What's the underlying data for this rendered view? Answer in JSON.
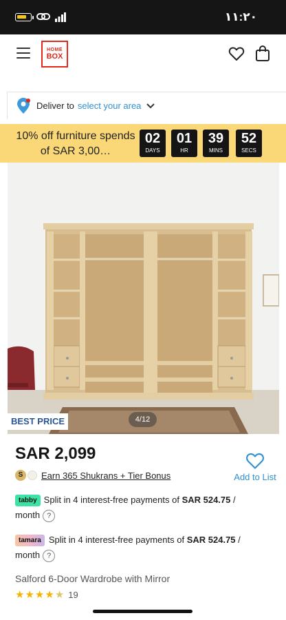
{
  "status_bar": {
    "time": "١١:٢٠"
  },
  "header": {
    "logo_line1": "HOME",
    "logo_line2": "BOX"
  },
  "delivery": {
    "label": "Deliver to",
    "area_link": "select your area"
  },
  "promo": {
    "text": "10% off furniture spends of SAR 3,00…",
    "countdown": [
      {
        "value": "02",
        "unit": "DAYS"
      },
      {
        "value": "01",
        "unit": "HR"
      },
      {
        "value": "39",
        "unit": "MINS"
      },
      {
        "value": "52",
        "unit": "SECS"
      }
    ]
  },
  "gallery": {
    "badge": "BEST PRICE",
    "pager": "4/12"
  },
  "product": {
    "price": "SAR 2,099",
    "shukran_text": "Earn 365 Shukrans + Tier Bonus",
    "add_to_list": "Add to List",
    "tabby": {
      "badge": "tabby",
      "text": "Split in 4 interest-free payments of",
      "amount": "SAR 524.75",
      "suffix": "/ month"
    },
    "tamara": {
      "badge": "tamara",
      "text": "Split in 4 interest-free payments of",
      "amount": "SAR 524.75",
      "suffix": "/ month"
    },
    "title": "Salford 6-Door Wardrobe with Mirror",
    "rating_count": "19",
    "rating_value": 4.5
  },
  "colors": {
    "accent": "#2f8fd0",
    "promo_bg": "#fad877",
    "logo_red": "#e0281e",
    "best_price": "#2a5596"
  }
}
